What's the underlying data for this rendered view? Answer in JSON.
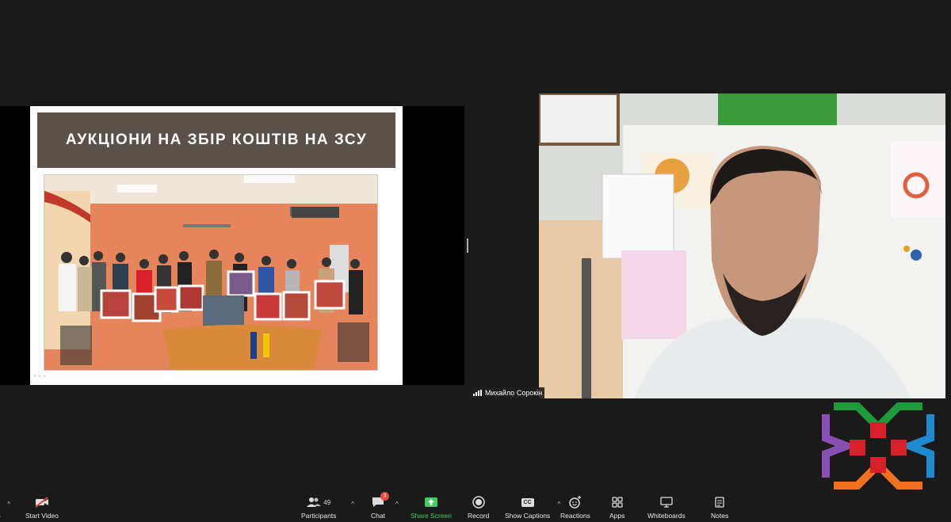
{
  "slide": {
    "title": "АУКЦІОНИ НА ЗБІР КОШТІВ НА ЗСУ"
  },
  "participant": {
    "name": "Михайло Сорокін"
  },
  "toolbar": {
    "audio_label": "io",
    "start_video_label": "Start Video",
    "participants_label": "Participants",
    "participants_count": "49",
    "chat_label": "Chat",
    "chat_badge": "3",
    "share_screen_label": "Share Screen",
    "record_label": "Record",
    "captions_label": "Show Captions",
    "captions_icon_text": "CC",
    "reactions_label": "Reactions",
    "apps_label": "Apps",
    "whiteboards_label": "Whiteboards",
    "notes_label": "Notes"
  },
  "colors": {
    "background": "#1a1a1a",
    "slide_title_bg": "#5c504b",
    "share_green": "#3ecf5e",
    "badge_red": "#e8453c",
    "logo_green": "#1e9a3c",
    "logo_blue": "#1e8ad0",
    "logo_purple": "#8a4fb3",
    "logo_orange": "#f07020",
    "logo_red": "#d8202a"
  }
}
